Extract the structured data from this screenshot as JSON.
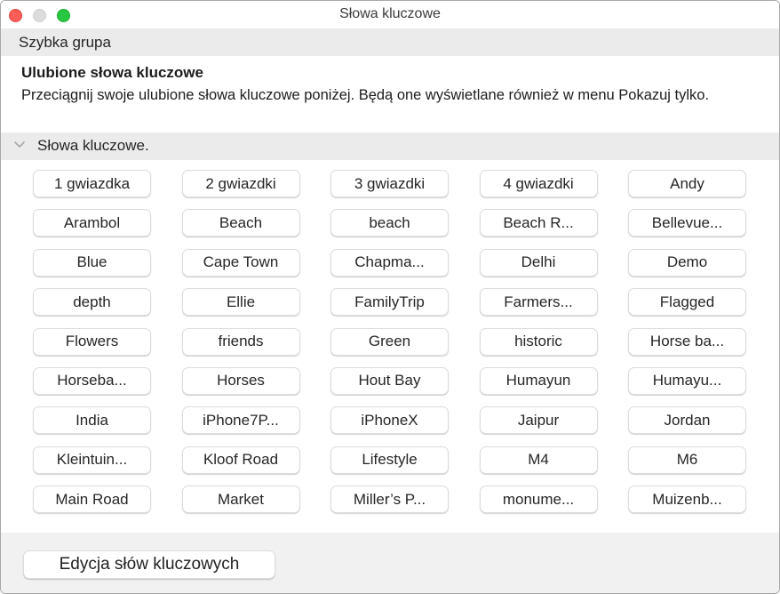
{
  "window": {
    "title": "Słowa kluczowe"
  },
  "quick_group": {
    "label": "Szybka grupa"
  },
  "favorites": {
    "heading": "Ulubione słowa kluczowe",
    "description": "Przeciągnij swoje ulubione słowa kluczowe poniżej. Będą one wyświetlane również w menu Pokazuj tylko."
  },
  "keywords_section": {
    "label": "Słowa kluczowe.",
    "expanded": true,
    "icon": "chevron-down-icon",
    "items": [
      "1 gwiazdka",
      "2 gwiazdki",
      "3 gwiazdki",
      "4 gwiazdki",
      "Andy",
      "Arambol",
      "Beach",
      "beach",
      "Beach R...",
      "Bellevue...",
      "Blue",
      "Cape Town",
      "Chapma...",
      "Delhi",
      "Demo",
      "depth",
      "Ellie",
      "FamilyTrip",
      "Farmers...",
      "Flagged",
      "Flowers",
      "friends",
      "Green",
      "historic",
      "Horse ba...",
      "Horseba...",
      "Horses",
      "Hout Bay",
      "Humayun",
      "Humayu...",
      "India",
      "iPhone7P...",
      "iPhoneX",
      "Jaipur",
      "Jordan",
      "Kleintuin...",
      "Kloof Road",
      "Lifestyle",
      "M4",
      "M6",
      "Main Road",
      "Market",
      "Miller’s P...",
      "monume...",
      "Muizenb..."
    ]
  },
  "footer": {
    "edit_button_label": "Edycja słów kluczowych"
  },
  "colors": {
    "close": "#fd5d57",
    "minimize_disabled": "#dcdcdc",
    "zoom": "#27c840",
    "band_background": "#ebebeb",
    "footer_background": "#f1f1f1"
  }
}
